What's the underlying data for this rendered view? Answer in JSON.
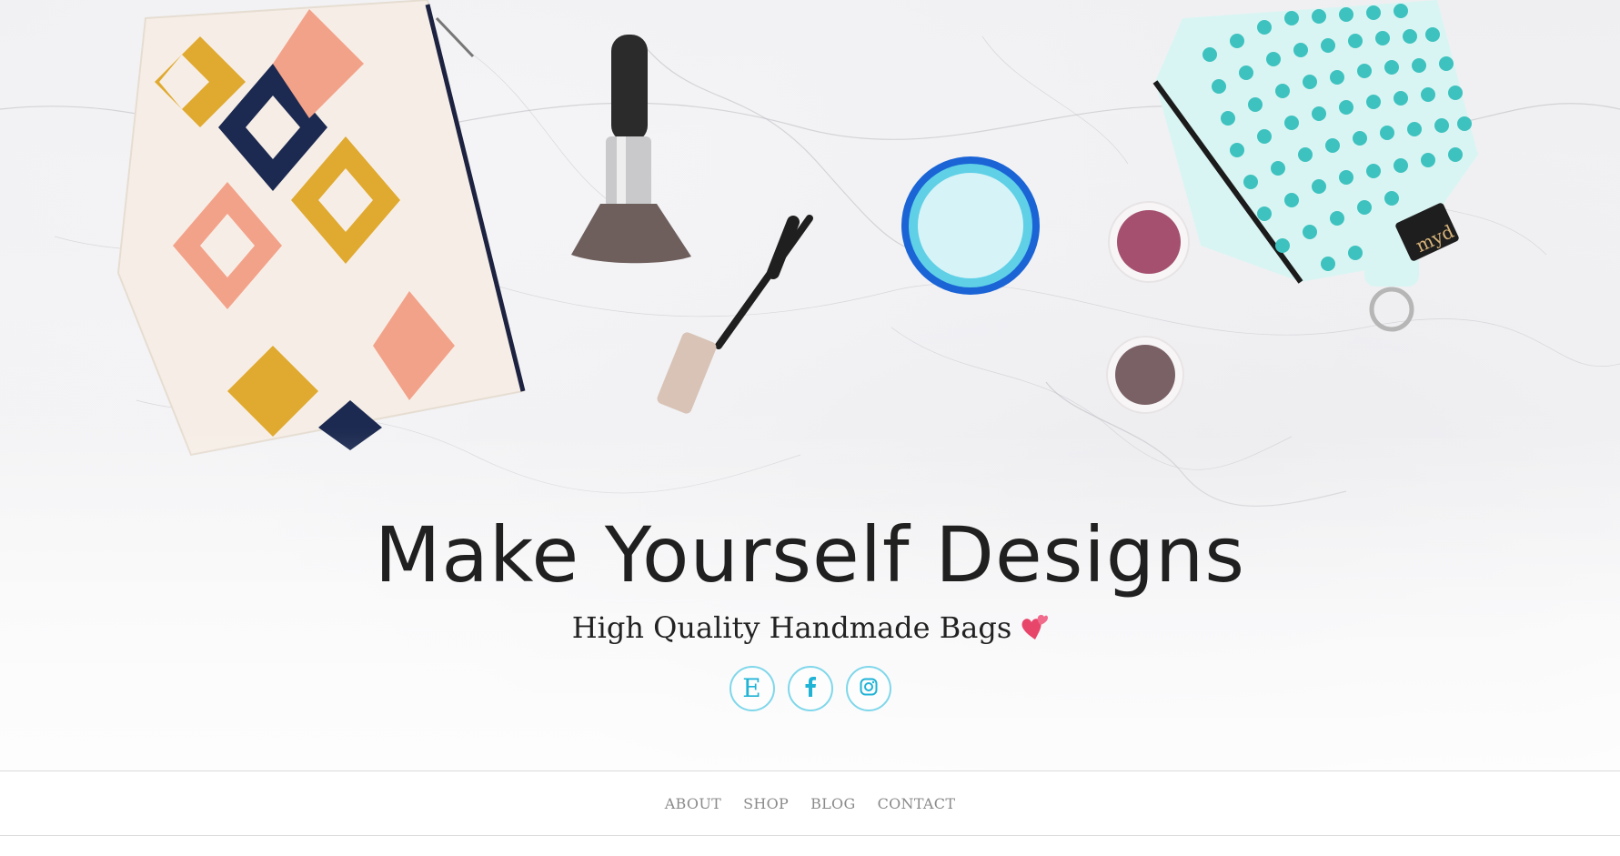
{
  "hero": {
    "title": "Make Yourself Designs",
    "subtitle": "High Quality Handmade Bags",
    "subtitle_emoji": "two-hearts-icon",
    "bag_tag_text": "myd"
  },
  "social": [
    {
      "name": "etsy-icon",
      "glyph": "E"
    },
    {
      "name": "facebook-icon"
    },
    {
      "name": "instagram-icon"
    }
  ],
  "nav": {
    "items": [
      "ABOUT",
      "SHOP",
      "BLOG",
      "CONTACT"
    ]
  },
  "colors": {
    "accent": "#1fb3d6",
    "accent_border": "#7fd7ea",
    "title": "#202020",
    "nav_text": "#8a8a8a",
    "heart": "#e8456b"
  }
}
